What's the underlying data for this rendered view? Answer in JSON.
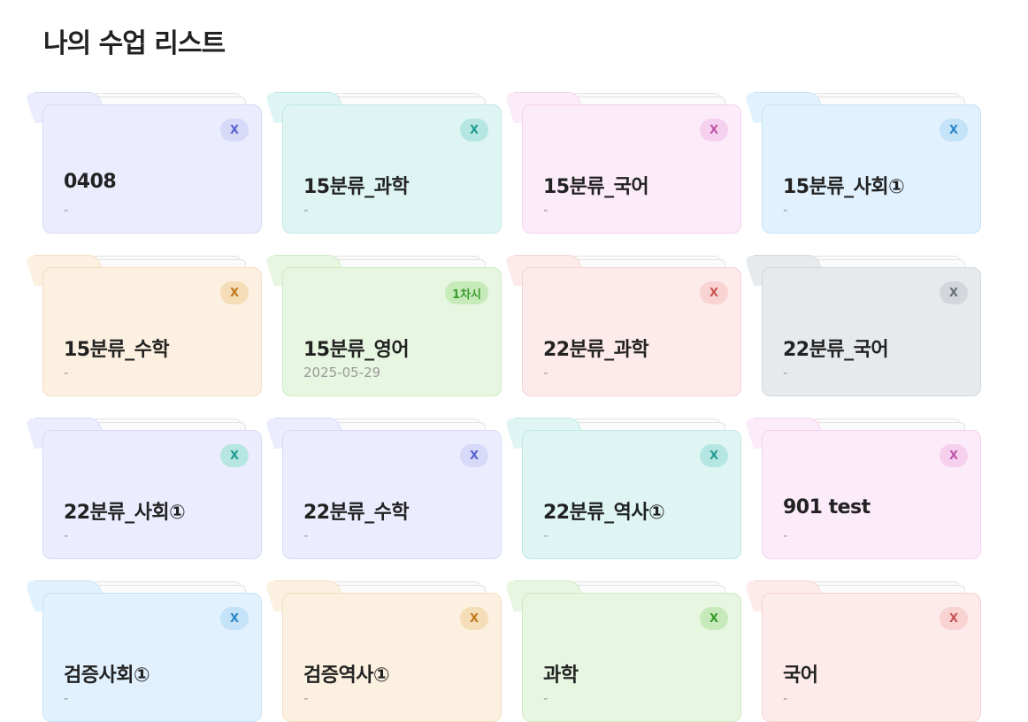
{
  "page_title": "나의 수업 리스트",
  "palette": {
    "lavender": {
      "bg": "#ebecfd",
      "border": "#d7daf5",
      "badge_bg": "#d6d9f8",
      "badge_fg": "#5b63d0"
    },
    "cyan": {
      "bg": "#def5f4",
      "border": "#bfe8e4",
      "badge_bg": "#b6e6e1",
      "badge_fg": "#229b91"
    },
    "pink": {
      "bg": "#fcebf9",
      "border": "#f4d2ef",
      "badge_bg": "#f6d1ef",
      "badge_fg": "#c156ad"
    },
    "sky": {
      "bg": "#e1f1fd",
      "border": "#c7e2f7",
      "badge_bg": "#c4e2f8",
      "badge_fg": "#2a86c8"
    },
    "peach": {
      "bg": "#fcf0e0",
      "border": "#f2dfc2",
      "badge_bg": "#f5ddb8",
      "badge_fg": "#c07a1c"
    },
    "green": {
      "bg": "#e7f6e1",
      "border": "#cfeac3",
      "badge_bg": "#c7eabb",
      "badge_fg": "#3b9a2c"
    },
    "rose": {
      "bg": "#fdeaea",
      "border": "#f5d3d3",
      "badge_bg": "#f8d3d2",
      "badge_fg": "#cb5353"
    },
    "gray": {
      "bg": "#e7eaed",
      "border": "#d3d7db",
      "badge_bg": "#d3d7dc",
      "badge_fg": "#6a7078"
    }
  },
  "folders": [
    {
      "name": "0408",
      "date": "-",
      "badge": "X",
      "color": "lavender"
    },
    {
      "name": "15분류_과학",
      "date": "-",
      "badge": "X",
      "color": "cyan"
    },
    {
      "name": "15분류_국어",
      "date": "-",
      "badge": "X",
      "color": "pink"
    },
    {
      "name": "15분류_사회①",
      "date": "-",
      "badge": "X",
      "color": "sky"
    },
    {
      "name": "15분류_수학",
      "date": "-",
      "badge": "X",
      "color": "peach"
    },
    {
      "name": "15분류_영어",
      "date": "2025-05-29",
      "badge": "1차시",
      "color": "green"
    },
    {
      "name": "22분류_과학",
      "date": "-",
      "badge": "X",
      "color": "rose"
    },
    {
      "name": "22분류_국어",
      "date": "-",
      "badge": "X",
      "color": "gray"
    },
    {
      "name": "22분류_사회①",
      "date": "-",
      "badge": "X",
      "color": "lavender",
      "badge_color": "cyan"
    },
    {
      "name": "22분류_수학",
      "date": "-",
      "badge": "X",
      "color": "lavender"
    },
    {
      "name": "22분류_역사①",
      "date": "-",
      "badge": "X",
      "color": "cyan"
    },
    {
      "name": "901 test",
      "date": "-",
      "badge": "X",
      "color": "pink"
    },
    {
      "name": "검증사회①",
      "date": "-",
      "badge": "X",
      "color": "sky"
    },
    {
      "name": "검증역사①",
      "date": "-",
      "badge": "X",
      "color": "peach"
    },
    {
      "name": "과학",
      "date": "-",
      "badge": "X",
      "color": "green"
    },
    {
      "name": "국어",
      "date": "-",
      "badge": "X",
      "color": "rose"
    }
  ]
}
